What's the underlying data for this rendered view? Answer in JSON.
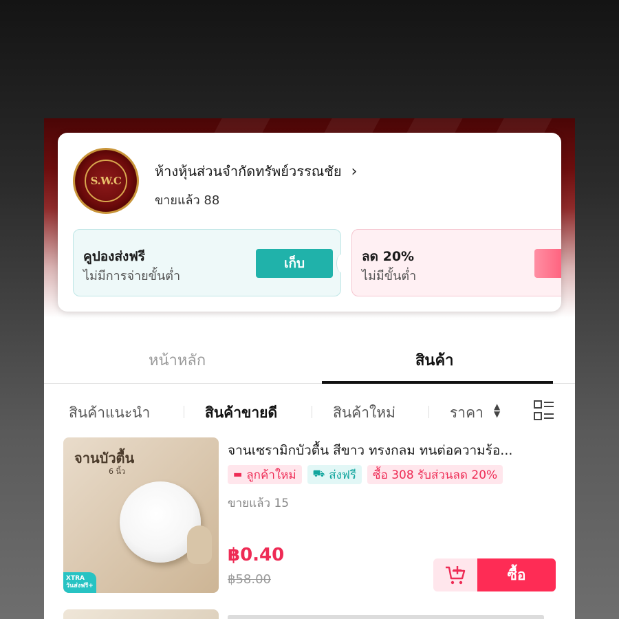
{
  "shop": {
    "logo_text": "S.W.C",
    "name": "ห้างหุ้นส่วนจำกัดทรัพย์วรรณชัย",
    "sold": "ขายแล้ว 88"
  },
  "coupons": [
    {
      "title": "คูปองส่งฟรี",
      "subtitle": "ไม่มีการจ่ายขั้นต่ำ",
      "button": "เก็บ"
    },
    {
      "title": "ลด 20%",
      "subtitle": "ไม่มีขั้นต่ำ"
    }
  ],
  "tabs": {
    "home": "หน้าหลัก",
    "products": "สินค้า"
  },
  "filters": {
    "recommended": "สินค้าแนะนำ",
    "best_selling": "สินค้าขายดี",
    "new": "สินค้าใหม่",
    "price": "ราคา"
  },
  "product": {
    "title": "จานเซรามิกบัวตื้น สีขาว ทรงกลม ทนต่อความร้อ...",
    "thumb_title": "จานบัวตื้น",
    "thumb_subtitle": "6 นิ้ว",
    "thumb_badge": "XTRA",
    "thumb_badge_sub": "วันส่งฟรี+",
    "badges": {
      "new_customer": "ลูกค้าใหม่",
      "free_shipping": "ส่งฟรี",
      "promo": "ซื้อ 308 รับส่วนลด 20%"
    },
    "sold": "ขายแล้ว 15",
    "price": "฿0.40",
    "original_price": "฿58.00",
    "buy_label": "ซื้อ"
  },
  "colors": {
    "accent": "#fe2c55",
    "teal": "#20b2aa",
    "hero_dark": "#4a0606"
  }
}
